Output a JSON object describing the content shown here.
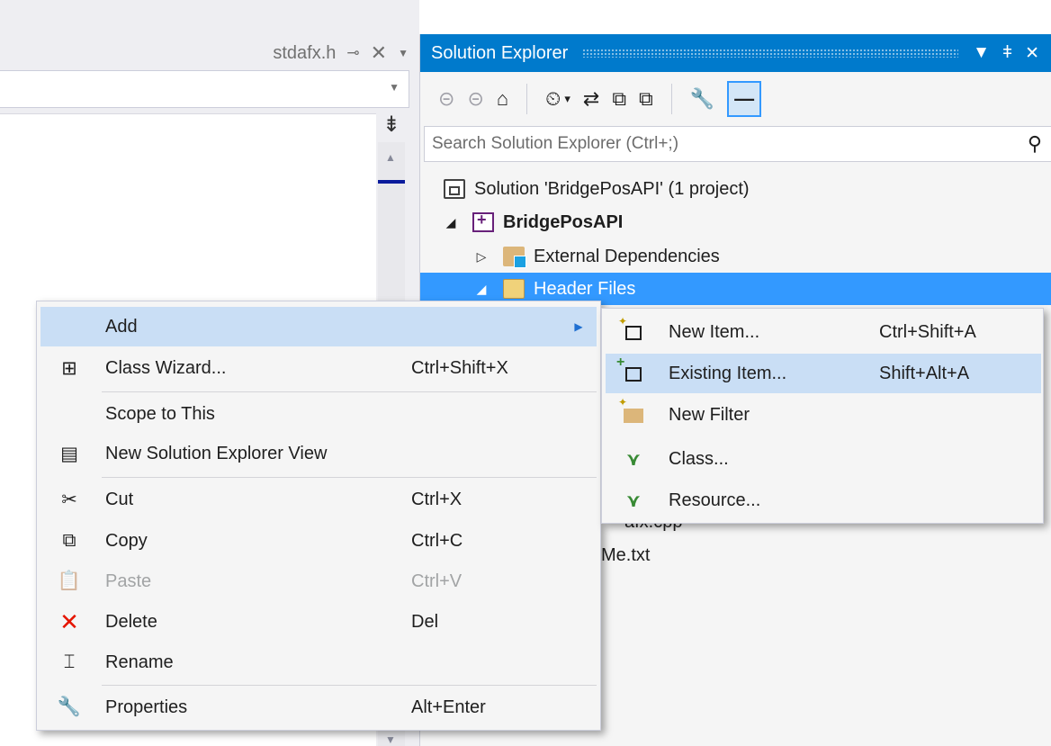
{
  "editor": {
    "tab_title": "stdafx.h",
    "pin_glyph": "⊸",
    "close_glyph": "✕",
    "dropdown_glyph": "▼",
    "splitter_glyph": "⇟"
  },
  "solution_explorer": {
    "title": "Solution Explorer",
    "controls": {
      "dropdown": "▼",
      "pin": "ǂ",
      "close": "✕"
    },
    "toolbar": [
      "⊝",
      "⊝",
      "⌂",
      "⏲",
      "⇄",
      "⧉",
      "⧉",
      "🔧",
      "—"
    ],
    "search_placeholder": "Search Solution Explorer (Ctrl+;)",
    "search_icon_glyph": "⚲",
    "tree": {
      "solution": "Solution 'BridgePosAPI' (1 project)",
      "project": "BridgePosAPI",
      "external_deps": "External Dependencies",
      "header_files": "Header Files",
      "behind_items": [
        "afx.cpp",
        "Me.txt"
      ]
    }
  },
  "context_menu": {
    "items": [
      {
        "icon": "",
        "label": "Add",
        "shortcut": "",
        "has_submenu": true,
        "hot": true
      },
      {
        "icon": "⊞",
        "label": "Class Wizard...",
        "shortcut": "Ctrl+Shift+X"
      },
      {
        "icon": "",
        "label": "Scope to This",
        "shortcut": ""
      },
      {
        "icon": "▤",
        "label": "New Solution Explorer View",
        "shortcut": ""
      },
      {
        "icon": "✂",
        "label": "Cut",
        "shortcut": "Ctrl+X"
      },
      {
        "icon": "⧉",
        "label": "Copy",
        "shortcut": "Ctrl+C"
      },
      {
        "icon": "📋",
        "label": "Paste",
        "shortcut": "Ctrl+V",
        "disabled": true
      },
      {
        "icon": "✕",
        "label": "Delete",
        "shortcut": "Del"
      },
      {
        "icon": "⌶",
        "label": "Rename",
        "shortcut": ""
      },
      {
        "icon": "🔧",
        "label": "Properties",
        "shortcut": "Alt+Enter"
      }
    ]
  },
  "submenu": {
    "items": [
      {
        "label": "New Item...",
        "shortcut": "Ctrl+Shift+A"
      },
      {
        "label": "Existing Item...",
        "shortcut": "Shift+Alt+A",
        "hot": true
      },
      {
        "label": "New Filter",
        "shortcut": ""
      },
      {
        "icon": "⋎",
        "label": "Class...",
        "shortcut": ""
      },
      {
        "icon": "⋎",
        "label": "Resource...",
        "shortcut": ""
      }
    ]
  },
  "colors": {
    "accent": "#007acc",
    "selection": "#3399ff",
    "menu_hot": "#c9def5",
    "menu_bg": "#f5f5f5",
    "delete_red": "#e51400"
  }
}
